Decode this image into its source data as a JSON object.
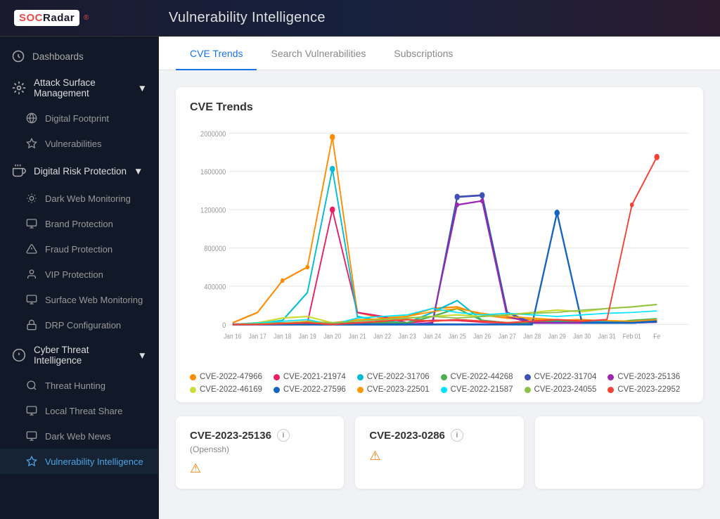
{
  "header": {
    "logo_text": "SOCRadar",
    "logo_mark": "®",
    "title": "Vulnerability Intelligence"
  },
  "sidebar": {
    "top_items": [
      {
        "id": "dashboards",
        "label": "Dashboards",
        "icon": "dashboard"
      }
    ],
    "sections": [
      {
        "id": "attack-surface",
        "label": "Attack Surface Management",
        "icon": "target",
        "expanded": true,
        "children": [
          {
            "id": "digital-footprint",
            "label": "Digital Footprint",
            "icon": "globe"
          },
          {
            "id": "vulnerabilities",
            "label": "Vulnerabilities",
            "icon": "bug"
          }
        ]
      },
      {
        "id": "digital-risk",
        "label": "Digital Risk Protection",
        "icon": "hand",
        "expanded": true,
        "children": [
          {
            "id": "dark-web",
            "label": "Dark Web Monitoring",
            "icon": "eye"
          },
          {
            "id": "brand",
            "label": "Brand Protection",
            "icon": "shield"
          },
          {
            "id": "fraud",
            "label": "Fraud Protection",
            "icon": "alert"
          },
          {
            "id": "vip",
            "label": "VIP Protection",
            "icon": "person"
          },
          {
            "id": "surface-web",
            "label": "Surface Web Monitoring",
            "icon": "monitor"
          },
          {
            "id": "drp-config",
            "label": "DRP Configuration",
            "icon": "settings"
          }
        ]
      },
      {
        "id": "cyber-threat",
        "label": "Cyber Threat Intelligence",
        "icon": "brain",
        "expanded": true,
        "children": [
          {
            "id": "threat-hunting",
            "label": "Threat Hunting",
            "icon": "search"
          },
          {
            "id": "local-threat",
            "label": "Local Threat Share",
            "icon": "share"
          },
          {
            "id": "dark-web-news",
            "label": "Dark Web News",
            "icon": "news"
          },
          {
            "id": "vuln-intel",
            "label": "Vulnerability Intelligence",
            "icon": "vuln",
            "active": true
          }
        ]
      }
    ]
  },
  "tabs": [
    {
      "id": "cve-trends",
      "label": "CVE Trends",
      "active": true
    },
    {
      "id": "search",
      "label": "Search Vulnerabilities"
    },
    {
      "id": "subscriptions",
      "label": "Subscriptions"
    }
  ],
  "chart": {
    "title": "CVE Trends",
    "y_labels": [
      "2000000",
      "1600000",
      "1200000",
      "800000",
      "400000",
      "0"
    ],
    "x_labels": [
      "Jan 16",
      "Jan 17",
      "Jan 18",
      "Jan 19",
      "Jan 20",
      "Jan 21",
      "Jan 22",
      "Jan 23",
      "Jan 24",
      "Jan 25",
      "Jan 26",
      "Jan 27",
      "Jan 28",
      "Jan 29",
      "Jan 30",
      "Jan 31",
      "Feb 01",
      "Fe"
    ],
    "legend": [
      {
        "id": "cve1",
        "label": "CVE-2022-47966",
        "color": "#FF8C00"
      },
      {
        "id": "cve2",
        "label": "CVE-2021-21974",
        "color": "#E91E63"
      },
      {
        "id": "cve3",
        "label": "CVE-2022-31706",
        "color": "#00BCD4"
      },
      {
        "id": "cve4",
        "label": "CVE-2022-44268",
        "color": "#4CAF50"
      },
      {
        "id": "cve5",
        "label": "CVE-2022-31704",
        "color": "#3F51B5"
      },
      {
        "id": "cve6",
        "label": "CVE-2023-25136",
        "color": "#9C27B0"
      },
      {
        "id": "cve7",
        "label": "CVE-2022-46169",
        "color": "#CDDC39"
      },
      {
        "id": "cve8",
        "label": "CVE-2022-27596",
        "color": "#1565C0"
      },
      {
        "id": "cve9",
        "label": "CVE-2023-22501",
        "color": "#FF9800"
      },
      {
        "id": "cve10",
        "label": "CVE-2022-21587",
        "color": "#00E5FF"
      },
      {
        "id": "cve11",
        "label": "CVE-2023-24055",
        "color": "#8BC34A"
      },
      {
        "id": "cve12",
        "label": "CVE-2023-22952",
        "color": "#F44336"
      }
    ]
  },
  "cve_cards": [
    {
      "id": "CVE-2023-25136",
      "subtitle": "(Openssh)",
      "icon": "warning"
    },
    {
      "id": "CVE-2023-0286",
      "subtitle": "",
      "icon": "warning"
    }
  ]
}
